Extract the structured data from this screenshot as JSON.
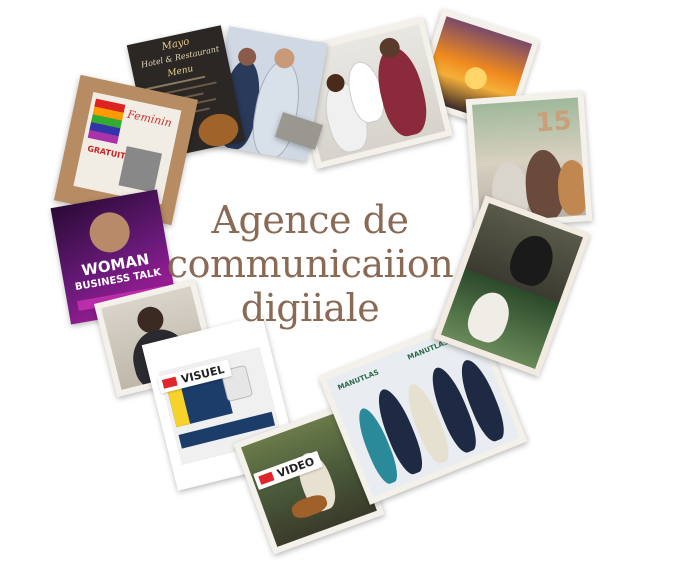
{
  "headline": {
    "line1": "Agence de",
    "line2": "communicaiion",
    "line3": "digiiale"
  },
  "cards": {
    "menu": {
      "title": "Hotel & Restaurant",
      "subtitle": "Menu",
      "brand": "Mayo"
    },
    "flyer_feminin": {
      "title": "Feminin",
      "badge": "GRATUIT"
    },
    "woman_business": {
      "line1": "WOMAN",
      "line2": "BUSINESS TALK"
    },
    "visuel": {
      "tag": "VISUEL"
    },
    "video": {
      "tag": "VIDEO"
    },
    "manutlas": {
      "brand": "MANUTLAS"
    }
  },
  "colors": {
    "headline": "#8a6a55",
    "frame": "#f4f0ea",
    "accent_red": "#e0262b",
    "purple": "#6a1a7a",
    "sunset": "#f08a1e"
  }
}
